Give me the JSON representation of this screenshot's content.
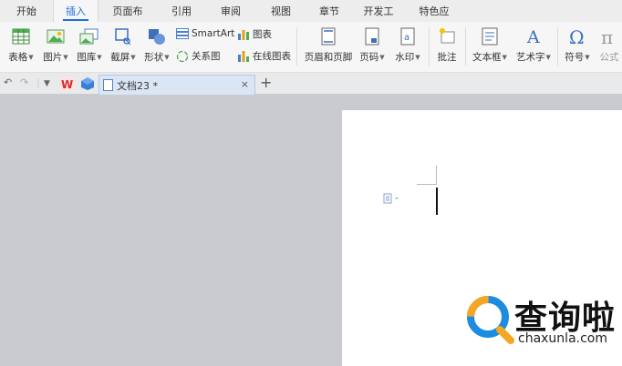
{
  "menu": {
    "tabs": [
      "开始",
      "插入",
      "页面布局",
      "引用",
      "审阅",
      "视图",
      "章节",
      "开发工具",
      "特色应用"
    ],
    "active": "插入"
  },
  "ribbon": {
    "table": "表格",
    "picture": "图片",
    "gallery": "图库",
    "screenshot": "截屏",
    "shape": "形状",
    "smartart": "SmartArt",
    "relation": "关系图",
    "chart": "图表",
    "online_chart": "在线图表",
    "header_footer": "页眉和页脚",
    "page_number": "页码",
    "watermark": "水印",
    "comment": "批注",
    "textbox": "文本框",
    "wordart": "艺术字",
    "symbol": "符号",
    "formula": "公式"
  },
  "tabstrip": {
    "doc_title": "文档23 *",
    "close": "×",
    "new_tab": "+"
  },
  "watermark": {
    "brand": "查询啦",
    "url": "chaxunla.com"
  },
  "colors": {
    "accent": "#1d6fd6",
    "background": "#c9cbd0",
    "ribbon": "#f6f6f7"
  }
}
